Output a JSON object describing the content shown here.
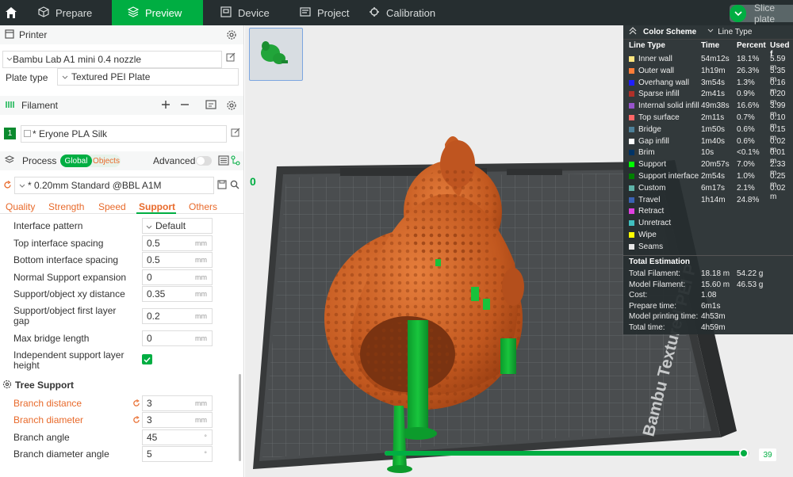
{
  "topbar": {
    "tabs": [
      {
        "label": "Prepare",
        "icon": "cube-icon"
      },
      {
        "label": "Preview",
        "icon": "layers-icon"
      },
      {
        "label": "Device",
        "icon": "device-icon"
      },
      {
        "label": "Project",
        "icon": "project-icon"
      },
      {
        "label": "Calibration",
        "icon": "calibration-icon"
      }
    ],
    "slice_label": "Slice plate",
    "accent": "#00ae42"
  },
  "printer": {
    "section_label": "Printer",
    "name": "Bambu Lab A1 mini 0.4 nozzle",
    "plate_type_label": "Plate type",
    "plate_type_value": "Textured PEI Plate"
  },
  "filament": {
    "section_label": "Filament",
    "index": "1",
    "name": "* Eryone PLA Silk"
  },
  "process": {
    "section_label": "Process",
    "toggle_global": "Global",
    "toggle_objects": "Objects",
    "advanced_label": "Advanced",
    "preset": "* 0.20mm Standard @BBL A1M",
    "tabs": [
      "Quality",
      "Strength",
      "Speed",
      "Support",
      "Others"
    ],
    "active_tab": "Support"
  },
  "support_settings": {
    "interface_pattern_label": "Interface pattern",
    "interface_pattern_value": "Default",
    "rows": [
      {
        "label": "Top interface spacing",
        "value": "0.5",
        "unit": "mm"
      },
      {
        "label": "Bottom interface spacing",
        "value": "0.5",
        "unit": "mm"
      },
      {
        "label": "Normal Support expansion",
        "value": "0",
        "unit": "mm"
      },
      {
        "label": "Support/object xy distance",
        "value": "0.35",
        "unit": "mm"
      },
      {
        "label": "Support/object first layer gap",
        "value": "0.2",
        "unit": "mm"
      },
      {
        "label": "Max bridge length",
        "value": "0",
        "unit": "mm"
      }
    ],
    "independent_label": "Independent support layer height",
    "independent_checked": true
  },
  "tree_support": {
    "heading": "Tree Support",
    "rows": [
      {
        "label": "Branch distance",
        "value": "3",
        "unit": "mm",
        "modified": true
      },
      {
        "label": "Branch diameter",
        "value": "3",
        "unit": "mm",
        "modified": true
      },
      {
        "label": "Branch angle",
        "value": "45",
        "unit": "°",
        "modified": false
      },
      {
        "label": "Branch diameter angle",
        "value": "5",
        "unit": "°",
        "modified": false
      }
    ]
  },
  "legend": {
    "title": "Color Scheme",
    "scheme": "Line Type",
    "headers": [
      "Line Type",
      "Time",
      "Percent",
      "Used f"
    ],
    "rows": [
      {
        "name": "Inner wall",
        "time": "54m12s",
        "percent": "18.1%",
        "used": "5.59 m",
        "color": "#ffe680"
      },
      {
        "name": "Outer wall",
        "time": "1h19m",
        "percent": "26.3%",
        "used": "5.35 m",
        "color": "#ff7d38"
      },
      {
        "name": "Overhang wall",
        "time": "3m54s",
        "percent": "1.3%",
        "used": "0.16 m",
        "color": "#1f1fff"
      },
      {
        "name": "Sparse infill",
        "time": "2m41s",
        "percent": "0.9%",
        "used": "0.20 m",
        "color": "#b03029"
      },
      {
        "name": "Internal solid infill",
        "time": "49m38s",
        "percent": "16.6%",
        "used": "3.99 m",
        "color": "#9654cc"
      },
      {
        "name": "Top surface",
        "time": "2m11s",
        "percent": "0.7%",
        "used": "0.10 m",
        "color": "#ff6666"
      },
      {
        "name": "Bridge",
        "time": "1m50s",
        "percent": "0.6%",
        "used": "0.15 m",
        "color": "#4d8099"
      },
      {
        "name": "Gap infill",
        "time": "1m40s",
        "percent": "0.6%",
        "used": "0.02 m",
        "color": "#ffffff"
      },
      {
        "name": "Brim",
        "time": "10s",
        "percent": "<0.1%",
        "used": "0.01 m",
        "color": "#003366"
      },
      {
        "name": "Support",
        "time": "20m57s",
        "percent": "7.0%",
        "used": "2.33 m",
        "color": "#00ff00"
      },
      {
        "name": "Support interface",
        "time": "2m54s",
        "percent": "1.0%",
        "used": "0.25 m",
        "color": "#008000"
      },
      {
        "name": "Custom",
        "time": "6m17s",
        "percent": "2.1%",
        "used": "0.02 m",
        "color": "#5eb3a8"
      },
      {
        "name": "Travel",
        "time": "1h14m",
        "percent": "24.8%",
        "used": "",
        "color": "#3a62b3"
      },
      {
        "name": "Retract",
        "time": "",
        "percent": "",
        "used": "",
        "color": "#e040e0"
      },
      {
        "name": "Unretract",
        "time": "",
        "percent": "",
        "used": "",
        "color": "#40c0c0"
      },
      {
        "name": "Wipe",
        "time": "",
        "percent": "",
        "used": "",
        "color": "#ffff00"
      },
      {
        "name": "Seams",
        "time": "",
        "percent": "",
        "used": "",
        "color": "#e6e6e6"
      }
    ],
    "estimation_title": "Total Estimation",
    "estimation": [
      {
        "key": "Total Filament:",
        "v1": "18.18 m",
        "v2": "54.22 g"
      },
      {
        "key": "Model Filament:",
        "v1": "15.60 m",
        "v2": "46.53 g"
      },
      {
        "key": "Cost:",
        "v1": "1.08",
        "v2": ""
      },
      {
        "key": "Prepare time:",
        "v1": "6m1s",
        "v2": ""
      },
      {
        "key": "Model printing time:",
        "v1": "4h53m",
        "v2": ""
      },
      {
        "key": "Total time:",
        "v1": "4h59m",
        "v2": ""
      }
    ]
  },
  "plate": {
    "label": "Bambu Textured PEI P",
    "number": "0"
  },
  "layer_slider": {
    "value": "39",
    "fraction": 0.99
  }
}
